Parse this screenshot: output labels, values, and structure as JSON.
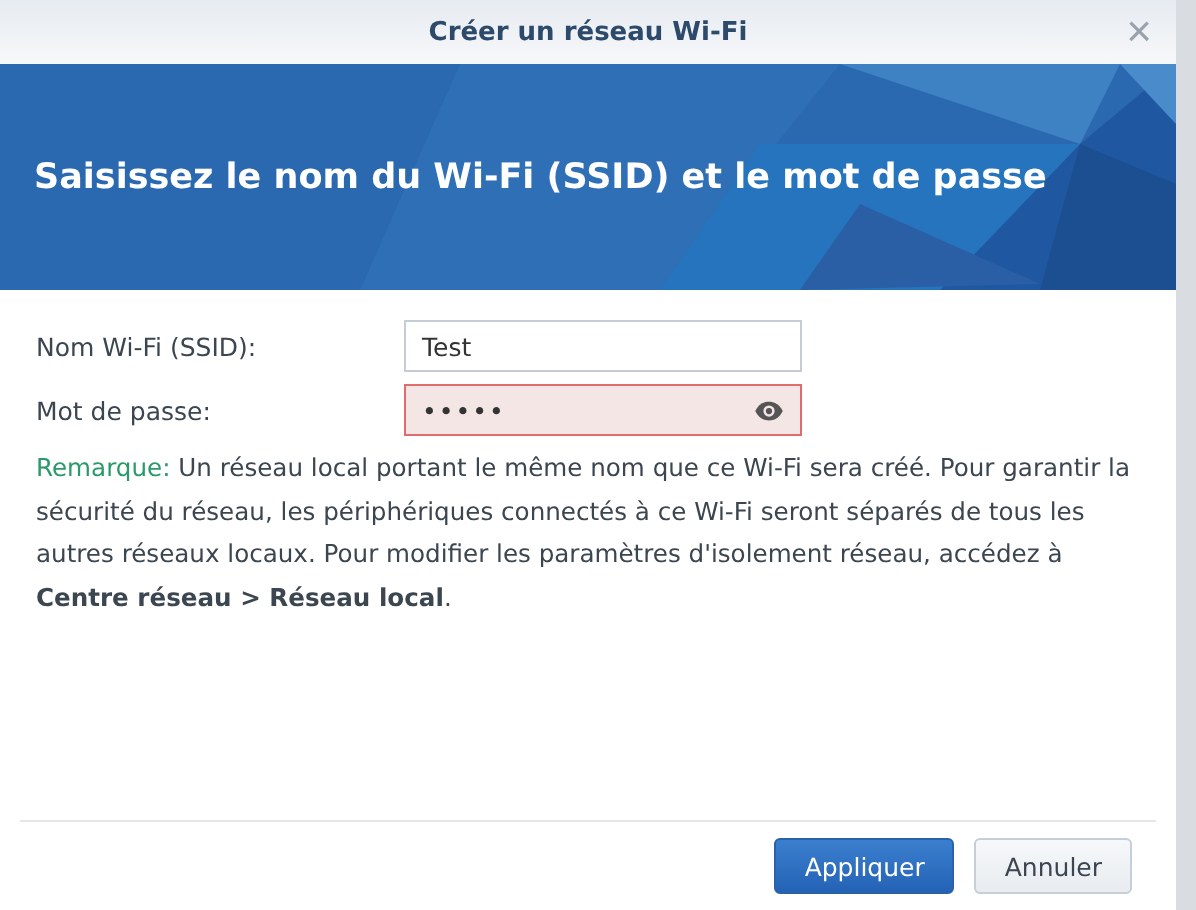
{
  "window": {
    "title": "Créer un réseau Wi-Fi",
    "close": "×"
  },
  "banner": {
    "heading": "Saisissez le nom du Wi-Fi (SSID) et le mot de passe"
  },
  "fields": [
    {
      "label": "Nom Wi-Fi (SSID):",
      "value": "Test",
      "kind": "text",
      "invalid": false
    },
    {
      "label": "Mot de passe:",
      "value": "•••••",
      "kind": "password",
      "invalid": true
    }
  ],
  "note": {
    "label": "Remarque:",
    "text": "Un réseau local portant le même nom que ce Wi-Fi sera créé. Pour garantir la sécurité du réseau, les périphériques connectés à ce Wi-Fi seront séparés de tous les autres réseaux locaux. Pour modifier les paramètres d'isolement réseau, accédez à **Centre réseau > Réseau local**."
  },
  "buttons": [
    {
      "label": "Appliquer",
      "kind": "primary"
    },
    {
      "label": "Annuler",
      "kind": "secondary"
    }
  ]
}
